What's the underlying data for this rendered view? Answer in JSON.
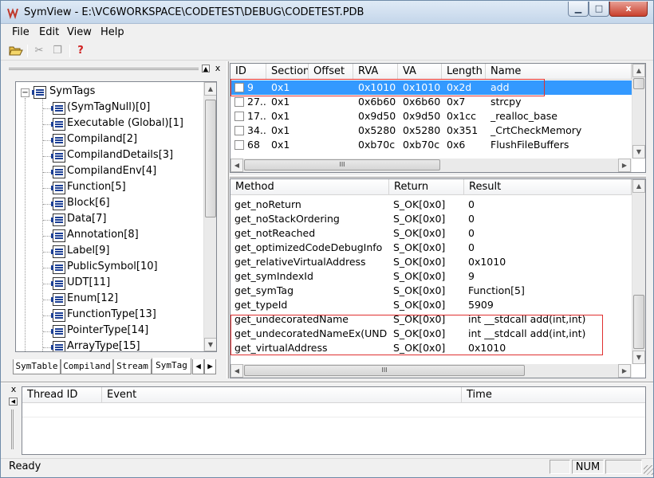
{
  "window": {
    "title": "SymView  -  E:\\VC6WORKSPACE\\CODETEST\\DEBUG\\CODETEST.PDB",
    "minimize_glyph": "▁",
    "maximize_glyph": "□",
    "close_glyph": "x"
  },
  "menu": [
    "File",
    "Edit",
    "View",
    "Help"
  ],
  "toolbar": {
    "open_icon": "folder-open-icon",
    "cut_glyph": "✂",
    "copy_glyph": "❐",
    "help_glyph": "?"
  },
  "tree": {
    "pane_close_glyph": "x",
    "root_toggle": "−",
    "root": "SymTags",
    "items": [
      "(SymTagNull)[0]",
      "Executable (Global)[1]",
      "Compiland[2]",
      "CompilandDetails[3]",
      "CompilandEnv[4]",
      "Function[5]",
      "Block[6]",
      "Data[7]",
      "Annotation[8]",
      "Label[9]",
      "PublicSymbol[10]",
      "UDT[11]",
      "Enum[12]",
      "FunctionType[13]",
      "PointerType[14]",
      "ArrayType[15]"
    ],
    "tabs": [
      "SymTable",
      "Compiland",
      "Stream",
      "SymTag"
    ],
    "tab_nav": [
      "◀",
      "▶"
    ],
    "selected_tab": "SymTag"
  },
  "symbols": {
    "columns": [
      "ID",
      "Section",
      "Offset",
      "RVA",
      "VA",
      "Length",
      "Name"
    ],
    "rows": [
      {
        "id": "9",
        "section": "0x1",
        "offset": "",
        "rva": "0x1010",
        "va": "0x1010",
        "length": "0x2d",
        "name": "add",
        "selected": true
      },
      {
        "id": "27...",
        "section": "0x1",
        "offset": "",
        "rva": "0x6b60",
        "va": "0x6b60",
        "length": "0x7",
        "name": "strcpy"
      },
      {
        "id": "17...",
        "section": "0x1",
        "offset": "",
        "rva": "0x9d50",
        "va": "0x9d50",
        "length": "0x1cc",
        "name": "_realloc_base"
      },
      {
        "id": "34...",
        "section": "0x1",
        "offset": "",
        "rva": "0x5280",
        "va": "0x5280",
        "length": "0x351",
        "name": "_CrtCheckMemory"
      },
      {
        "id": "68",
        "section": "0x1",
        "offset": "",
        "rva": "0xb70c",
        "va": "0xb70c",
        "length": "0x6",
        "name": "FlushFileBuffers"
      }
    ]
  },
  "methods": {
    "columns": [
      "Method",
      "Return",
      "Result"
    ],
    "rows": [
      {
        "method": "get_noReturn",
        "ret": "S_OK[0x0]",
        "result": "0"
      },
      {
        "method": "get_noStackOrdering",
        "ret": "S_OK[0x0]",
        "result": "0"
      },
      {
        "method": "get_notReached",
        "ret": "S_OK[0x0]",
        "result": "0"
      },
      {
        "method": "get_optimizedCodeDebugInfo",
        "ret": "S_OK[0x0]",
        "result": "0"
      },
      {
        "method": "get_relativeVirtualAddress",
        "ret": "S_OK[0x0]",
        "result": "0x1010"
      },
      {
        "method": "get_symIndexId",
        "ret": "S_OK[0x0]",
        "result": "9"
      },
      {
        "method": "get_symTag",
        "ret": "S_OK[0x0]",
        "result": "Function[5]"
      },
      {
        "method": "get_typeId",
        "ret": "S_OK[0x0]",
        "result": "5909"
      },
      {
        "method": "get_undecoratedName",
        "ret": "S_OK[0x0]",
        "result": "int __stdcall add(int,int)"
      },
      {
        "method": "get_undecoratedNameEx(UND...",
        "ret": "S_OK[0x0]",
        "result": "int __stdcall add(int,int)"
      },
      {
        "method": "get_virtualAddress",
        "ret": "S_OK[0x0]",
        "result": "0x1010"
      }
    ]
  },
  "log": {
    "pane_close_glyph": "x",
    "columns": [
      "Thread ID",
      "Event",
      "Time"
    ]
  },
  "statusbar": {
    "text": "Ready",
    "num": "NUM"
  },
  "colors": {
    "selection": "#3399ff",
    "highlight_box": "#e03030",
    "icon_blue": "#1c3f94"
  }
}
